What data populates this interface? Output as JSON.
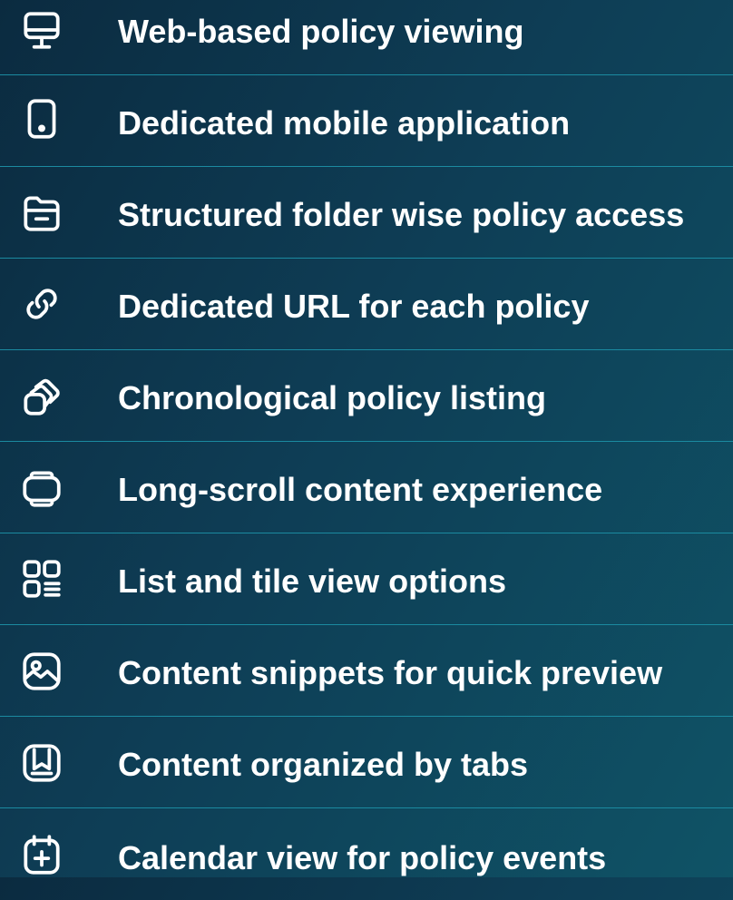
{
  "features": [
    {
      "label": "Web-based policy viewing",
      "icon": "monitor-icon"
    },
    {
      "label": "Dedicated mobile application",
      "icon": "mobile-phone-icon"
    },
    {
      "label": "Structured folder wise policy access",
      "icon": "folder-icon"
    },
    {
      "label": "Dedicated URL for each policy",
      "icon": "link-icon"
    },
    {
      "label": "Chronological policy listing",
      "icon": "stacked-shapes-icon"
    },
    {
      "label": "Long-scroll content experience",
      "icon": "scroll-icon"
    },
    {
      "label": "List and tile view options",
      "icon": "grid-list-icon"
    },
    {
      "label": "Content snippets for quick preview",
      "icon": "image-icon"
    },
    {
      "label": "Content organized by tabs",
      "icon": "tabs-icon"
    },
    {
      "label": "Calendar view for policy events",
      "icon": "calendar-add-icon"
    }
  ],
  "colors": {
    "background_start": "#0b2b40",
    "background_end": "#0f5366",
    "divider": "#1b8aa0",
    "text": "#ffffff"
  }
}
